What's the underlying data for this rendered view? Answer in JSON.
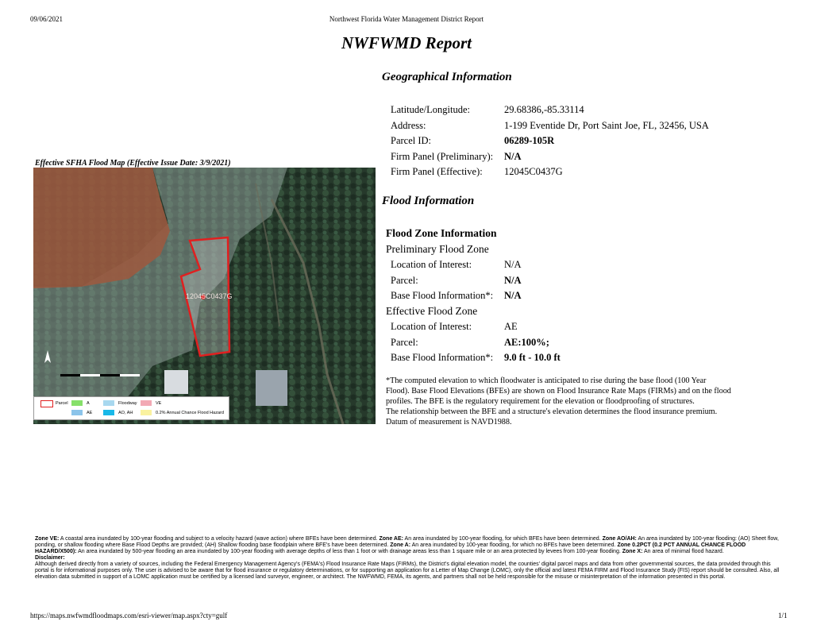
{
  "header": {
    "date": "09/06/2021",
    "report_name": "Northwest Florida Water Management District Report"
  },
  "title": "NWFWMD Report",
  "geographical": {
    "heading": "Geographical Information",
    "rows": [
      {
        "label": "Latitude/Longitude:",
        "value": "29.68386,-85.33114"
      },
      {
        "label": "Address:",
        "value": "1-199 Eventide Dr, Port Saint Joe, FL, 32456, USA"
      },
      {
        "label": "Parcel ID:",
        "value": "06289-105R"
      },
      {
        "label": "Firm Panel (Preliminary):",
        "value": "N/A"
      },
      {
        "label": "Firm Panel (Effective):",
        "value": "12045C0437G"
      }
    ]
  },
  "map": {
    "title": "Effective SFHA Flood Map (Effective Issue Date: 3/9/2021)",
    "center_label": "12045C0437G",
    "legend": {
      "parcel": "Parcel",
      "a": "A",
      "floodway": "Floodway",
      "ve": "VE",
      "ae": "AE",
      "ao_ah": "AO, AH",
      "pct": "0.2% Annual Chance Flood Hazard"
    },
    "colors": {
      "parcel": "#e02020",
      "a": "#86e06a",
      "floodway": "#a8d8ef",
      "ve": "#f2a9b4",
      "ae": "#8cc4ea",
      "ao_ah": "#19b8e8",
      "pct": "#faf2a0",
      "ve_zone_fill": "#9a5a40"
    }
  },
  "flood": {
    "heading": "Flood Information",
    "zone_title": "Flood Zone Information",
    "preliminary": {
      "heading": "Preliminary Flood Zone",
      "rows": [
        {
          "label": "Location of Interest:",
          "value": "N/A"
        },
        {
          "label": "Parcel:",
          "value": "N/A"
        },
        {
          "label": "Base Flood Information*:",
          "value": "N/A"
        }
      ]
    },
    "effective": {
      "heading": "Effective Flood Zone",
      "rows": [
        {
          "label": "Location of Interest:",
          "value": "AE"
        },
        {
          "label": "Parcel:",
          "value": "AE:100%;"
        },
        {
          "label": "Base Flood Information*:",
          "value": "9.0 ft - 10.0 ft"
        }
      ]
    },
    "footnote": [
      "*The computed elevation to which floodwater is anticipated to rise during the base flood (100 Year",
      "Flood). Base Flood Elevations (BFEs) are shown on Flood Insurance Rate Maps (FIRMs) and on the flood",
      "profiles. The BFE is the regulatory requirement for the elevation or floodproofing of structures.",
      "The relationship between the BFE and a structure's elevation determines the flood insurance premium.",
      "Datum of measurement is NAVD1988."
    ]
  },
  "notes": {
    "ve_label": "Zone VE:",
    "ve_text": "A coastal area inundated by 100-year flooding and subject to a velocity hazard (wave action) where BFEs have been determined.",
    "ae_label": "Zone AE:",
    "ae_text": "An area inundated by 100-year flooding, for which BFEs have been determined.",
    "aoah_label": "Zone AO/AH:",
    "aoah_text": "An area inundated by 100-year flooding: (AO) Sheet flow, ponding, or shallow flooding where Base Flood Depths are provided; (AH) Shallow flooding base floodplain where BFE's have been determined.",
    "a_label": "Zone A:",
    "a_text": "An area inundated by 100-year flooding, for which no BFEs have been determined.",
    "pct_label": "Zone 0.2PCT (0.2 PCT ANNUAL CHANCE FLOOD HAZARD/X500):",
    "pct_text": "An area inundated by 500-year flooding an area inundated by 100-year flooding with average depths of less than 1 foot or with drainage areas less than 1 square mile or an area protected by levees from 100-year flooding.",
    "x_label": "Zone X:",
    "x_text": "An area of minimal flood hazard.",
    "disclaimer_label": "Disclaimer:",
    "disclaimer_text": "Although derived directly from a variety of sources, including the Federal Emergency Management Agency's (FEMA's) Flood Insurance Rate Maps (FIRMs), the District's digital elevation model, the counties' digital parcel maps and data from other governmental sources, the data provided through this portal is for informational purposes only. The user is advised to be aware that for flood insurance or regulatory determinations, or for supporting an application for a Letter of Map Change (LOMC), only the official and latest FEMA FIRM and Flood Insurance Study (FIS) report should be consulted. Also, all elevation data submitted in support of a LOMC application must be certified by a licensed land surveyor, engineer, or architect. The NWFWMD, FEMA, its agents, and partners shall not be held responsible for the misuse or misinterpretation of the information presented in this portal."
  },
  "footer": {
    "url": "https://maps.nwfwmdfloodmaps.com/esri-viewer/map.aspx?cty=gulf",
    "page": "1/1"
  }
}
